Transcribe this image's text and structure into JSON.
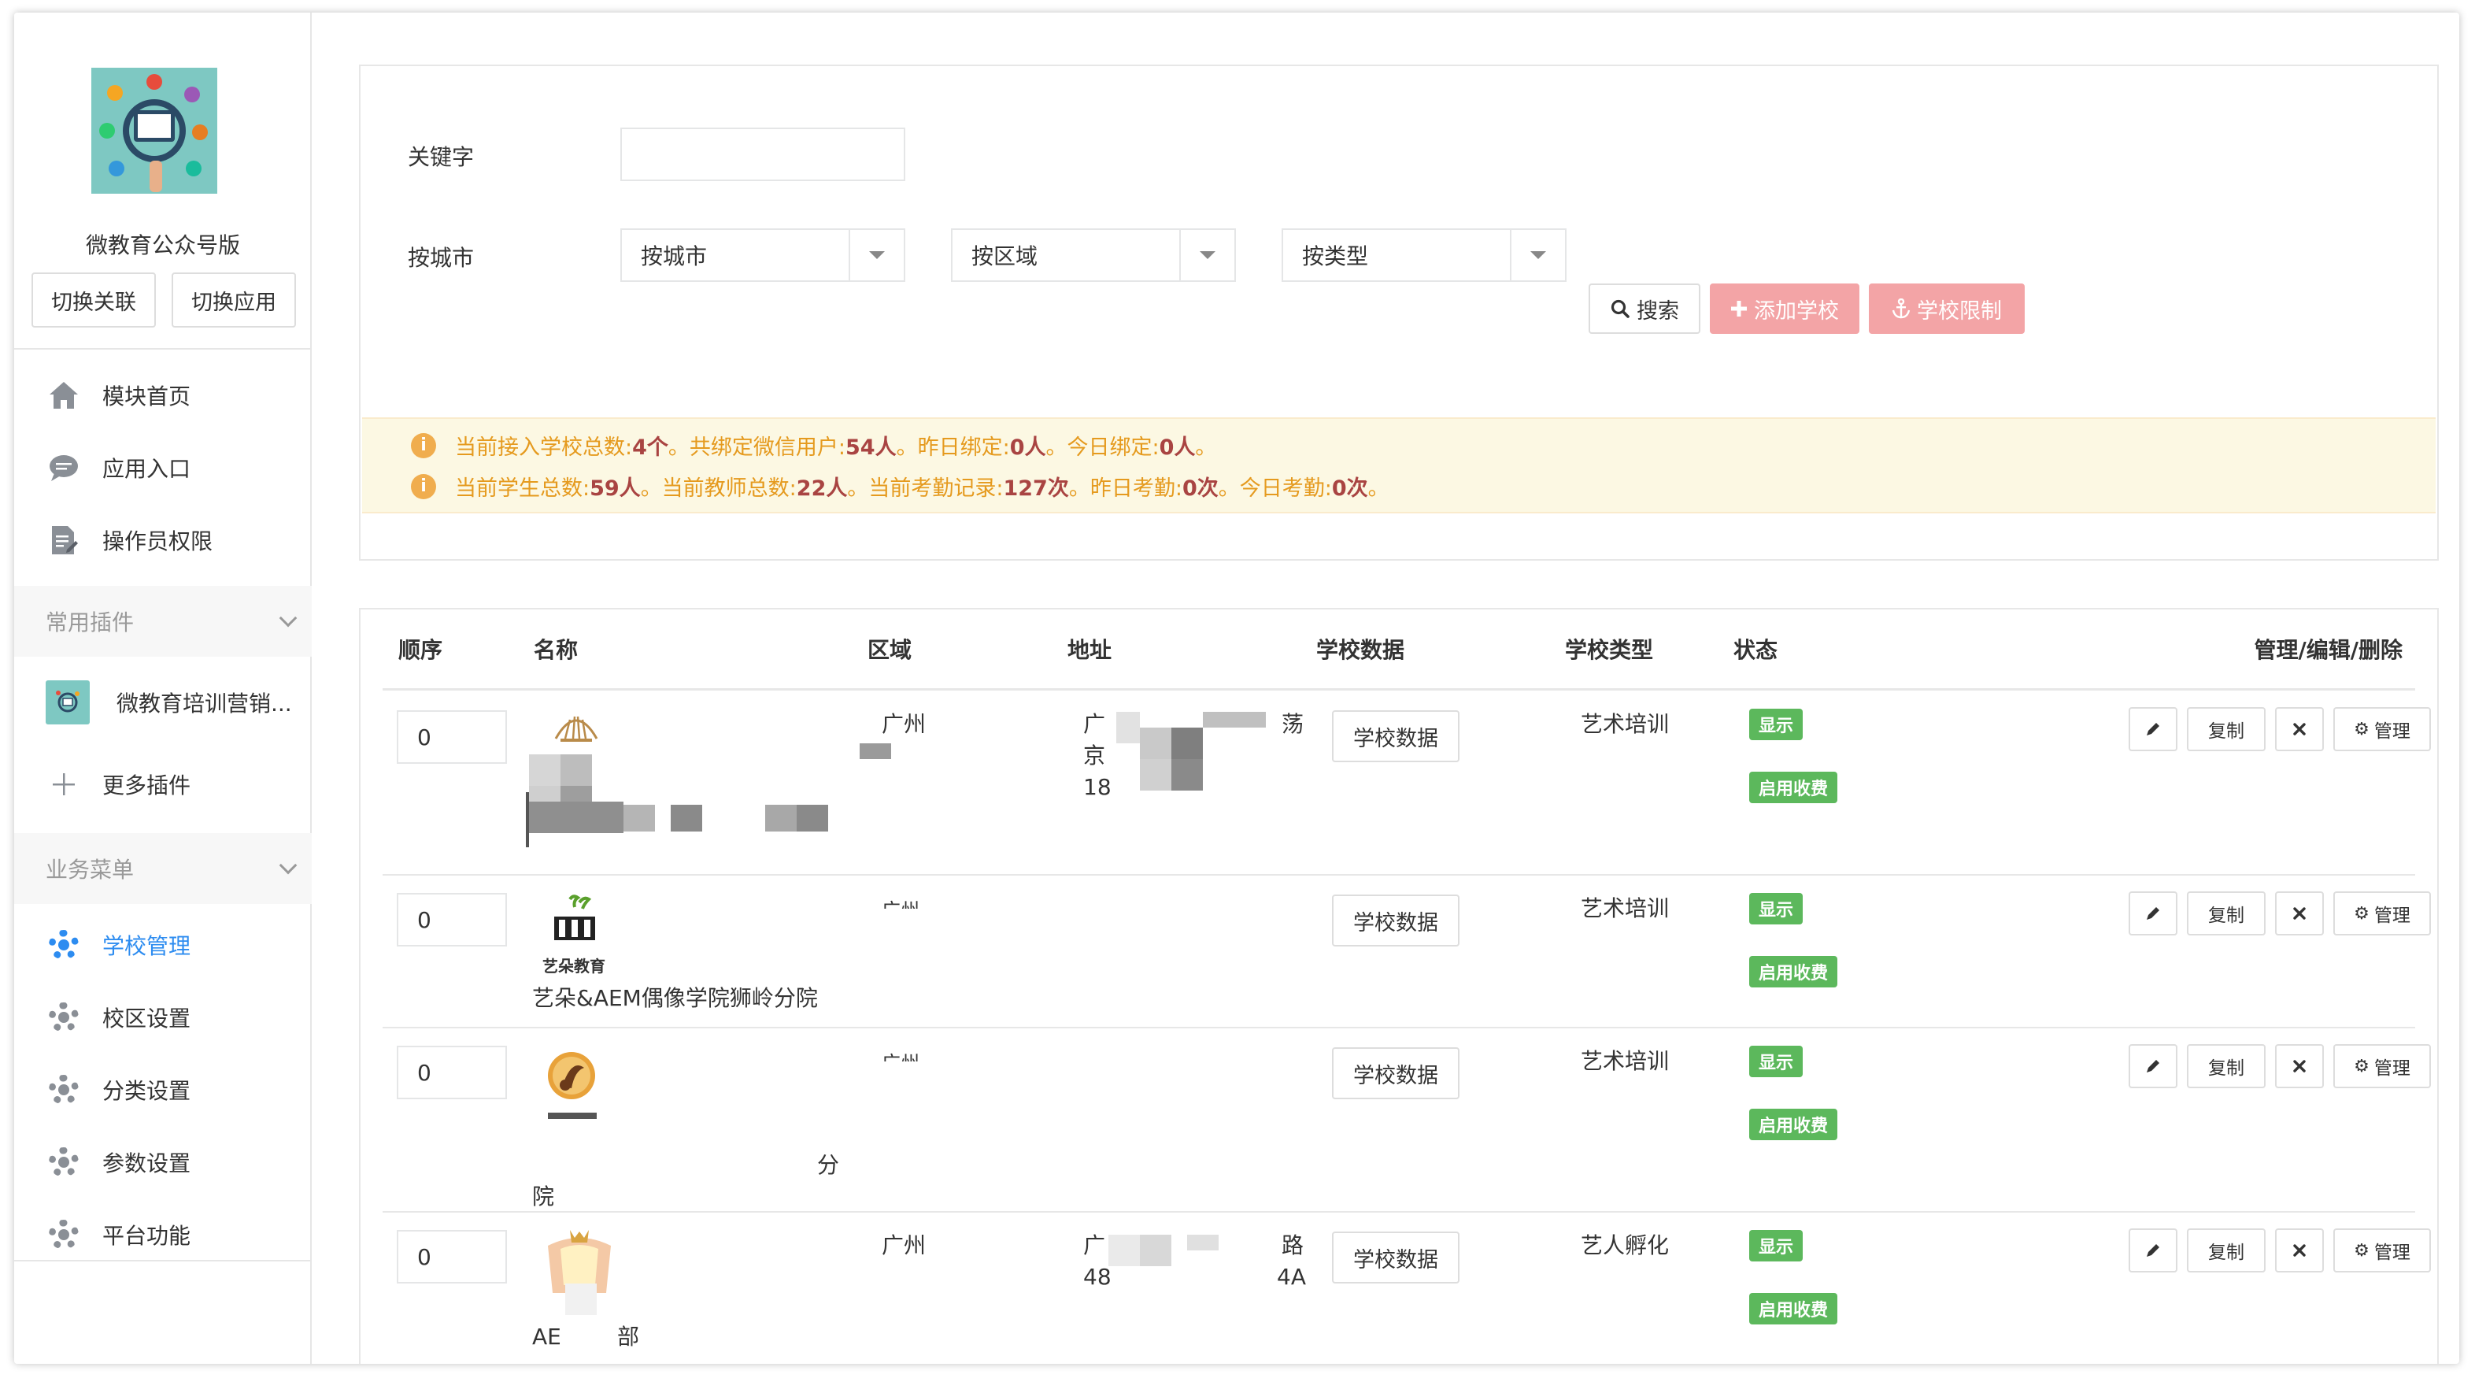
{
  "sidebar": {
    "app_name": "微教育公众号版",
    "switch_link": "切换关联",
    "switch_app": "切换应用",
    "items": [
      {
        "label": "模块首页",
        "icon": "home-icon"
      },
      {
        "label": "应用入口",
        "icon": "comment-icon"
      },
      {
        "label": "操作员权限",
        "icon": "file-edit-icon"
      }
    ],
    "plugins_group": "常用插件",
    "plugins": [
      {
        "label": "微教育培训营销...",
        "icon": "plugin-thumbnail"
      },
      {
        "label": "更多插件",
        "icon": "plus-icon"
      }
    ],
    "business_group": "业务菜单",
    "business": [
      {
        "label": "学校管理",
        "icon": "gear-icon",
        "active": true
      },
      {
        "label": "校区设置",
        "icon": "gear-icon"
      },
      {
        "label": "分类设置",
        "icon": "gear-icon"
      },
      {
        "label": "参数设置",
        "icon": "gear-icon"
      },
      {
        "label": "平台功能",
        "icon": "gear-icon"
      }
    ]
  },
  "filters": {
    "keyword_label": "关键字",
    "keyword_value": "",
    "city_label": "按城市",
    "city_select": "按城市",
    "area_select": "按区域",
    "type_select": "按类型",
    "search_btn": "搜索",
    "add_btn": "添加学校",
    "limit_btn": "学校限制"
  },
  "notice": {
    "line1": [
      {
        "t": "当前接入学校总数:"
      },
      {
        "b": "4个"
      },
      {
        "t": "。共绑定微信用户:"
      },
      {
        "b": "54人"
      },
      {
        "t": "。昨日绑定:"
      },
      {
        "b": "0人"
      },
      {
        "t": "。今日绑定:"
      },
      {
        "b": "0人"
      },
      {
        "t": "。"
      }
    ],
    "line2": [
      {
        "t": "当前学生总数:"
      },
      {
        "b": "59人"
      },
      {
        "t": "。当前教师总数:"
      },
      {
        "b": "22人"
      },
      {
        "t": "。当前考勤记录:"
      },
      {
        "b": "127次"
      },
      {
        "t": "。昨日考勤:"
      },
      {
        "b": "0次"
      },
      {
        "t": "。今日考勤:"
      },
      {
        "b": "0次"
      },
      {
        "t": "。"
      }
    ]
  },
  "table": {
    "headers": {
      "order": "顺序",
      "name": "名称",
      "area": "区域",
      "address": "地址",
      "school_data": "学校数据",
      "school_type": "学校类型",
      "status": "状态",
      "actions": "管理/编辑/删除"
    },
    "rows": [
      {
        "order": "0",
        "name": "",
        "area": "广州",
        "address_lines": [
          "广",
          "京",
          "18"
        ],
        "address_tail": "荡",
        "data_btn": "学校数据",
        "type": "艺术培训",
        "badge_show": "显示",
        "badge_fee": "启用收费"
      },
      {
        "order": "0",
        "name": "艺朵&AEM偶像学院狮岭分院",
        "logo_text": "艺朵教育",
        "area": "广州",
        "address_lines": [],
        "data_btn": "学校数据",
        "type": "艺术培训",
        "badge_show": "显示",
        "badge_fee": "启用收费"
      },
      {
        "order": "0",
        "name_tail": "分",
        "name_line2": "院",
        "area": "广州",
        "address_lines": [],
        "data_btn": "学校数据",
        "type": "艺术培训",
        "badge_show": "显示",
        "badge_fee": "启用收费"
      },
      {
        "order": "0",
        "name": "AE",
        "name_tail": "部",
        "area": "广州",
        "address_lines": [
          "广",
          "48"
        ],
        "address_tail": "路",
        "address_tail2": "4A",
        "data_btn": "学校数据",
        "type": "艺人孵化",
        "badge_show": "显示",
        "badge_fee": "启用收费"
      }
    ],
    "actions": {
      "copy": "复制",
      "manage": "管理"
    }
  },
  "colors": {
    "accent": "#2d8cf0",
    "danger": "#f3a4a6",
    "success": "#5cb85c",
    "warning_text": "#e59a1e",
    "warning_bg": "#fcf8e3"
  }
}
